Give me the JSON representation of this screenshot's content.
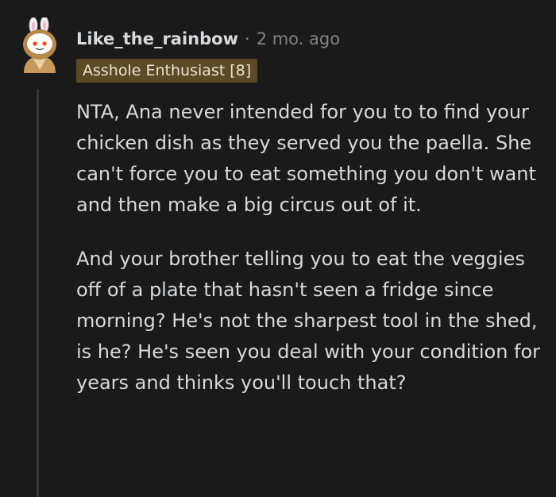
{
  "comment": {
    "username": "Like_the_rainbow",
    "separator": "·",
    "timestamp": "2 mo. ago",
    "flair": "Asshole Enthusiast [8]",
    "avatar_icon": "snoo-bunny-avatar-icon",
    "paragraphs": [
      "NTA, Ana never intended for you to to find your chicken dish as they served you the paella. She can't force you to eat something you don't want and then make a big circus out of it.",
      "And your brother telling you to eat the veggies off of a plate that hasn't seen a fridge since morning? He's not the sharpest tool in the shed, is he? He's seen you deal with your condition for years and thinks you'll touch that?"
    ]
  },
  "colors": {
    "background": "#1a1a1b",
    "text": "#d7dadc",
    "muted": "#818384",
    "flair_bg": "#5c4a26",
    "thread_line": "#343536"
  }
}
